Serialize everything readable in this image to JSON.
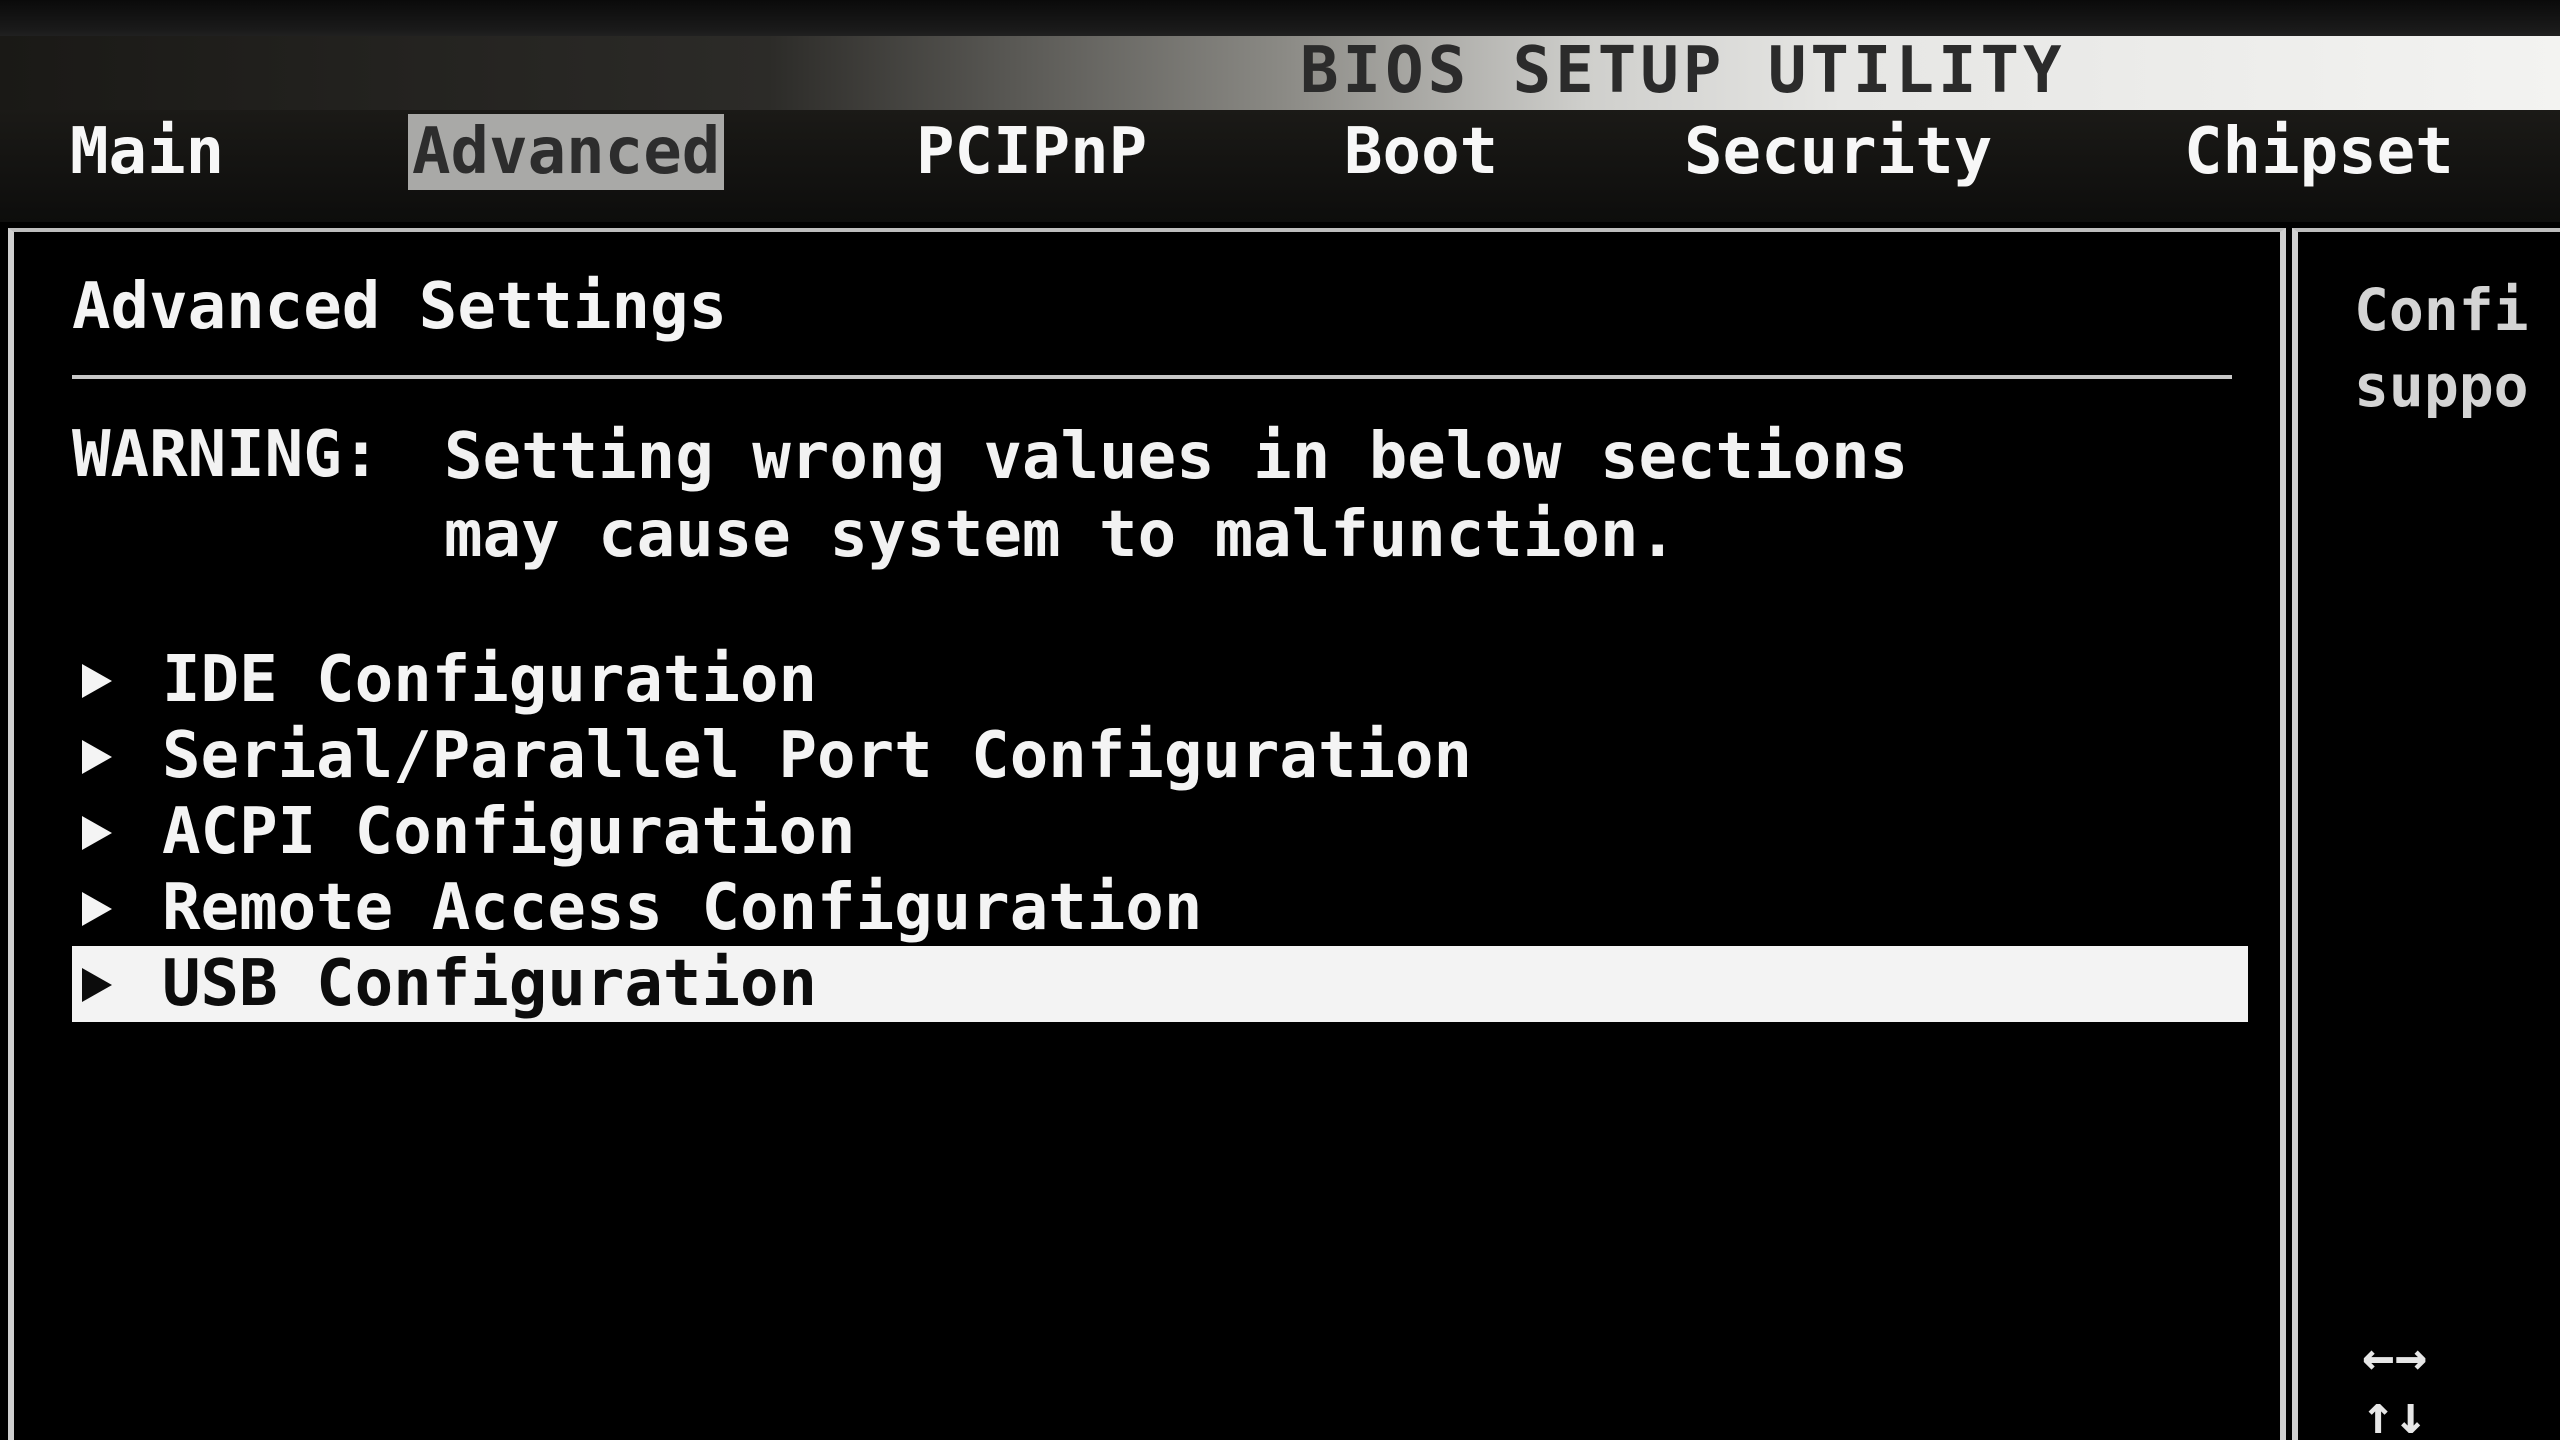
{
  "app": {
    "title": "BIOS SETUP UTILITY"
  },
  "menu_bar": {
    "tabs": [
      {
        "label": "Main",
        "active": false
      },
      {
        "label": "Advanced",
        "active": true
      },
      {
        "label": "PCIPnP",
        "active": false
      },
      {
        "label": "Boot",
        "active": false
      },
      {
        "label": "Security",
        "active": false
      },
      {
        "label": "Chipset",
        "active": false
      }
    ]
  },
  "main": {
    "title": "Advanced Settings",
    "warning_label": "WARNING:",
    "warning_text": "Setting wrong values in below sections\nmay cause system to malfunction.",
    "items": [
      {
        "label": "IDE Configuration",
        "selected": false
      },
      {
        "label": "Serial/Parallel Port Configuration",
        "selected": false
      },
      {
        "label": "ACPI Configuration",
        "selected": false
      },
      {
        "label": "Remote Access Configuration",
        "selected": false
      },
      {
        "label": "USB Configuration",
        "selected": true
      }
    ]
  },
  "help": {
    "text": "Confi\nsuppo",
    "nav_hints": [
      "←→",
      "↑↓"
    ]
  },
  "colors": {
    "background": "#000000",
    "text": "#f4f4f4",
    "active_tab_bg": "#a9a9a7",
    "selected_item_bg": "#f3f3f3"
  }
}
